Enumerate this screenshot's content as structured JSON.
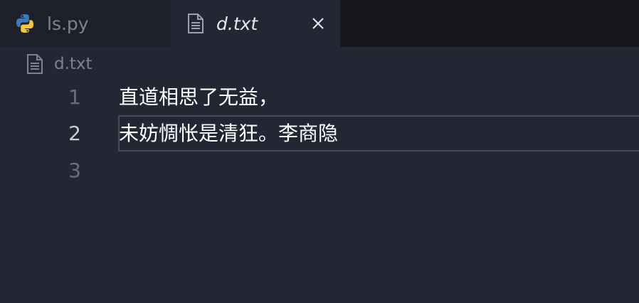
{
  "tabs": [
    {
      "label": "ls.py",
      "icon": "python-icon",
      "active": false
    },
    {
      "label": "d.txt",
      "icon": "text-file-icon",
      "active": true
    }
  ],
  "breadcrumb": {
    "label": "d.txt",
    "icon": "text-file-icon"
  },
  "editor": {
    "lines": [
      {
        "number": "1",
        "text": "直道相思了无益，"
      },
      {
        "number": "2",
        "text": "未妨惆怅是清狂。李商隐"
      },
      {
        "number": "3",
        "text": ""
      }
    ],
    "current_line": "2"
  },
  "colors": {
    "background": "#232733",
    "tabbar": "#14161c",
    "inactive_tab": "#1d2029",
    "text": "#ffffff",
    "muted": "#7d8290",
    "python_blue": "#3d7ab8",
    "python_yellow": "#f5c53b"
  }
}
